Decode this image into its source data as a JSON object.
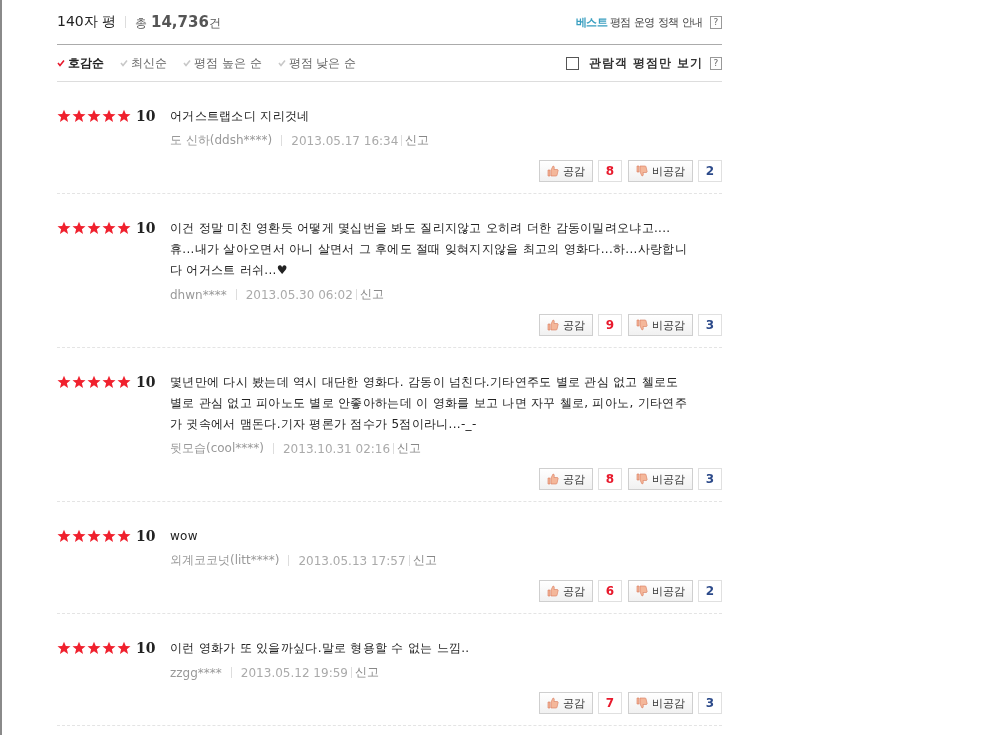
{
  "header": {
    "title": "140자 평",
    "total": "총 **14,736**건",
    "policy_link": {
      "highlight": "베스트",
      "text": "평점 운영 정책 안내"
    },
    "help": "?"
  },
  "sort_options": [
    {
      "label": "호감순",
      "selected": true
    },
    {
      "label": "최신순",
      "selected": false
    },
    {
      "label": "평점 높은 순",
      "selected": false
    },
    {
      "label": "평점 낮은 순",
      "selected": false
    }
  ],
  "filter": {
    "label": "관람객 평점만 보기",
    "checked": false,
    "help": "?"
  },
  "reviews": [
    {
      "stars": 5,
      "score": "10",
      "text": "어거스트랩소디 지리것네",
      "author": "도 신하(ddsh****)",
      "date": "2013.05.17 16:34",
      "report": "신고",
      "like_label": "공감",
      "likes": "8",
      "dislike_label": "비공감",
      "dislikes": "2"
    },
    {
      "stars": 5,
      "score": "10",
      "text": "이건 정말 미친 영환듯 어떻게 몇십번을 봐도 질리지않고 오히려 더한 감동이밀려오냐고.... 휴...내가 살아오면서 아니 살면서 그 후에도 절때 잊혀지지않을 최고의 영화다...하...사랑합니다 어거스트 러쉬...♥",
      "author": "dhwn****",
      "date": "2013.05.30 06:02",
      "report": "신고",
      "like_label": "공감",
      "likes": "9",
      "dislike_label": "비공감",
      "dislikes": "3"
    },
    {
      "stars": 5,
      "score": "10",
      "text": "몇년만에 다시 봤는데 역시 대단한 영화다. 감동이 넘친다.기타연주도 별로 관심 없고 첼로도 별로 관심 없고 피아노도 별로 안좋아하는데 이 영화를 보고 나면 자꾸 첼로, 피아노, 기타연주가 귓속에서 맴돈다.기자 평론가 점수가 5점이라니...-_-",
      "author": "뒷모습(cool****)",
      "date": "2013.10.31 02:16",
      "report": "신고",
      "like_label": "공감",
      "likes": "8",
      "dislike_label": "비공감",
      "dislikes": "3"
    },
    {
      "stars": 5,
      "score": "10",
      "text": "wow",
      "author": "외계코코넛(litt****)",
      "date": "2013.05.13 17:57",
      "report": "신고",
      "like_label": "공감",
      "likes": "6",
      "dislike_label": "비공감",
      "dislikes": "2"
    },
    {
      "stars": 5,
      "score": "10",
      "text": "이런 영화가 또 있을까싶다.말로 형용할 수 없는 느낌..",
      "author": "zzgg****",
      "date": "2013.05.12 19:59",
      "report": "신고",
      "like_label": "공감",
      "likes": "7",
      "dislike_label": "비공감",
      "dislikes": "3"
    }
  ]
}
